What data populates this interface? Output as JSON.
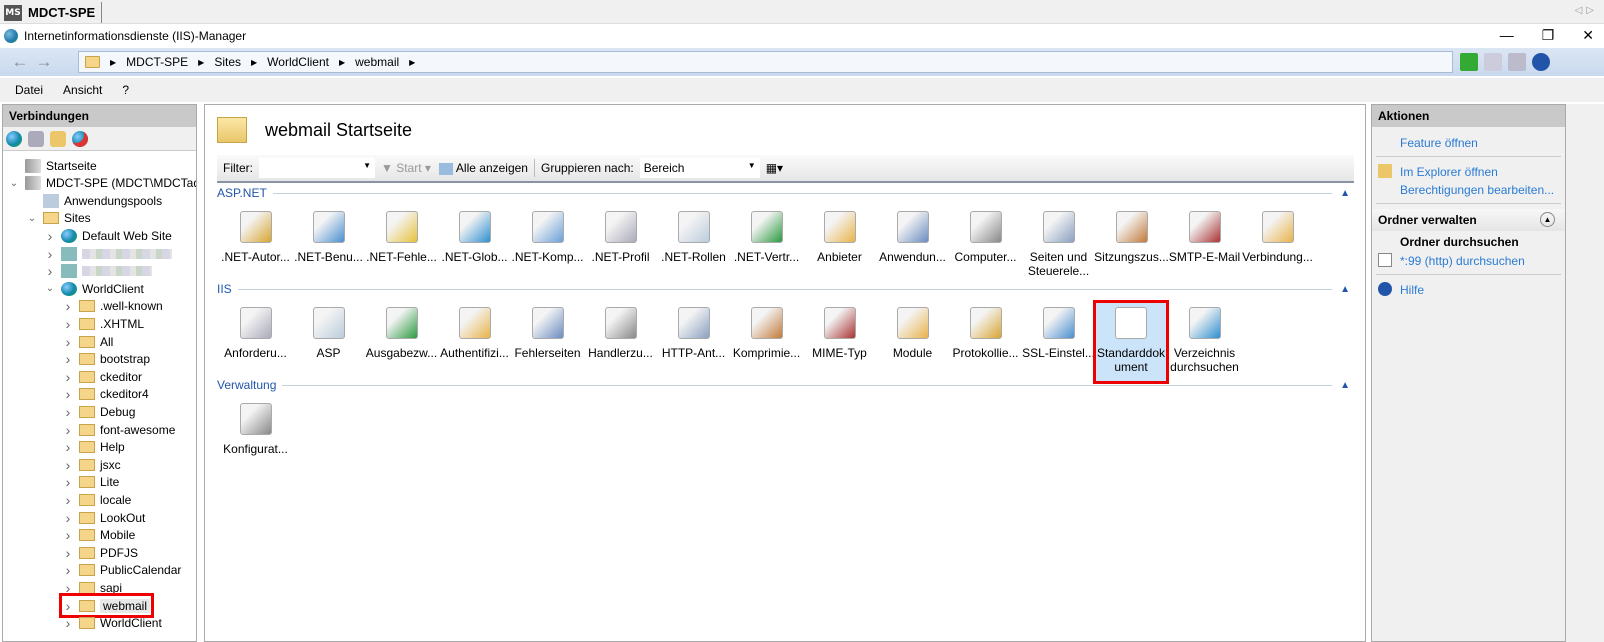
{
  "tab": {
    "title": "MDCT-SPE",
    "logo": "MS"
  },
  "window": {
    "title": "Internetinformationsdienste (IIS)-Manager",
    "controls": [
      "—",
      "❐",
      "✕"
    ]
  },
  "address": {
    "breadcrumbs": [
      "MDCT-SPE",
      "Sites",
      "WorldClient",
      "webmail"
    ]
  },
  "menu": [
    "Datei",
    "Ansicht",
    "?"
  ],
  "connections": {
    "title": "Verbindungen",
    "tree": [
      {
        "label": "Startseite",
        "level": 0,
        "arrow": "",
        "icon": "server"
      },
      {
        "label": "MDCT-SPE (MDCT\\MDCTadmin)",
        "level": 0,
        "arrow": "v",
        "icon": "server"
      },
      {
        "label": "Anwendungspools",
        "level": 1,
        "arrow": "",
        "icon": "pools"
      },
      {
        "label": "Sites",
        "level": 1,
        "arrow": "v",
        "icon": "folder"
      },
      {
        "label": "Default Web Site",
        "level": 2,
        "arrow": ">",
        "icon": "globe"
      },
      {
        "label": "",
        "level": 2,
        "arrow": ">",
        "icon": "blur"
      },
      {
        "label": "",
        "level": 2,
        "arrow": ">",
        "icon": "blur"
      },
      {
        "label": "WorldClient",
        "level": 2,
        "arrow": "v",
        "icon": "globe"
      },
      {
        "label": ".well-known",
        "level": 3,
        "arrow": ">",
        "icon": "folder"
      },
      {
        "label": ".XHTML",
        "level": 3,
        "arrow": ">",
        "icon": "folder"
      },
      {
        "label": "All",
        "level": 3,
        "arrow": ">",
        "icon": "folder"
      },
      {
        "label": "bootstrap",
        "level": 3,
        "arrow": ">",
        "icon": "folder"
      },
      {
        "label": "ckeditor",
        "level": 3,
        "arrow": ">",
        "icon": "folder"
      },
      {
        "label": "ckeditor4",
        "level": 3,
        "arrow": ">",
        "icon": "folder"
      },
      {
        "label": "Debug",
        "level": 3,
        "arrow": ">",
        "icon": "folder"
      },
      {
        "label": "font-awesome",
        "level": 3,
        "arrow": ">",
        "icon": "folder"
      },
      {
        "label": "Help",
        "level": 3,
        "arrow": ">",
        "icon": "folder"
      },
      {
        "label": "jsxc",
        "level": 3,
        "arrow": ">",
        "icon": "folder"
      },
      {
        "label": "Lite",
        "level": 3,
        "arrow": ">",
        "icon": "folder"
      },
      {
        "label": "locale",
        "level": 3,
        "arrow": ">",
        "icon": "folder"
      },
      {
        "label": "LookOut",
        "level": 3,
        "arrow": ">",
        "icon": "folder"
      },
      {
        "label": "Mobile",
        "level": 3,
        "arrow": ">",
        "icon": "folder"
      },
      {
        "label": "PDFJS",
        "level": 3,
        "arrow": ">",
        "icon": "folder"
      },
      {
        "label": "PublicCalendar",
        "level": 3,
        "arrow": ">",
        "icon": "folder"
      },
      {
        "label": "sapi",
        "level": 3,
        "arrow": ">",
        "icon": "folder"
      },
      {
        "label": "webmail",
        "level": 3,
        "arrow": ">",
        "icon": "folder",
        "selected": true
      },
      {
        "label": "WorldClient",
        "level": 3,
        "arrow": ">",
        "icon": "folder"
      }
    ]
  },
  "main": {
    "title": "webmail Startseite",
    "filter": {
      "label": "Filter:",
      "value": "",
      "start": "Start",
      "show_all": "Alle anzeigen",
      "group_by_label": "Gruppieren nach:",
      "group_by_value": "Bereich"
    },
    "groups": [
      {
        "name": "ASP.NET",
        "items": [
          ".NET-Autor...",
          ".NET-Benu...",
          ".NET-Fehle...",
          ".NET-Glob...",
          ".NET-Komp...",
          ".NET-Profil",
          ".NET-Rollen",
          ".NET-Vertr...",
          "Anbieter",
          "Anwendun...",
          "Computer...",
          "Seiten und Steuerele...",
          "Sitzungszus...",
          "SMTP-E-Mail",
          "Verbindung..."
        ]
      },
      {
        "name": "IIS",
        "items": [
          "Anforderu...",
          "ASP",
          "Ausgabezw...",
          "Authentifizi...",
          "Fehlerseiten",
          "Handlerzu...",
          "HTTP-Ant...",
          "Komprimie...",
          "MIME-Typ",
          "Module",
          "Protokollie...",
          "SSL-Einstel...",
          "Standarddok ument",
          "Verzeichnis durchsuchen"
        ],
        "selected": "Standarddok ument"
      },
      {
        "name": "Verwaltung",
        "items": [
          "Konfigurat..."
        ]
      }
    ]
  },
  "actions": {
    "title": "Aktionen",
    "items": [
      "Feature öffnen",
      "Im Explorer öffnen",
      "Berechtigungen bearbeiten..."
    ],
    "section": "Ordner verwalten",
    "browse_title": "Ordner durchsuchen",
    "browse_link": "*:99 (http) durchsuchen",
    "help": "Hilfe"
  },
  "colors": {
    "link": "#2a7bd4",
    "group": "#2255aa",
    "selection": "#cce4fa",
    "highlight": "#e00000"
  }
}
